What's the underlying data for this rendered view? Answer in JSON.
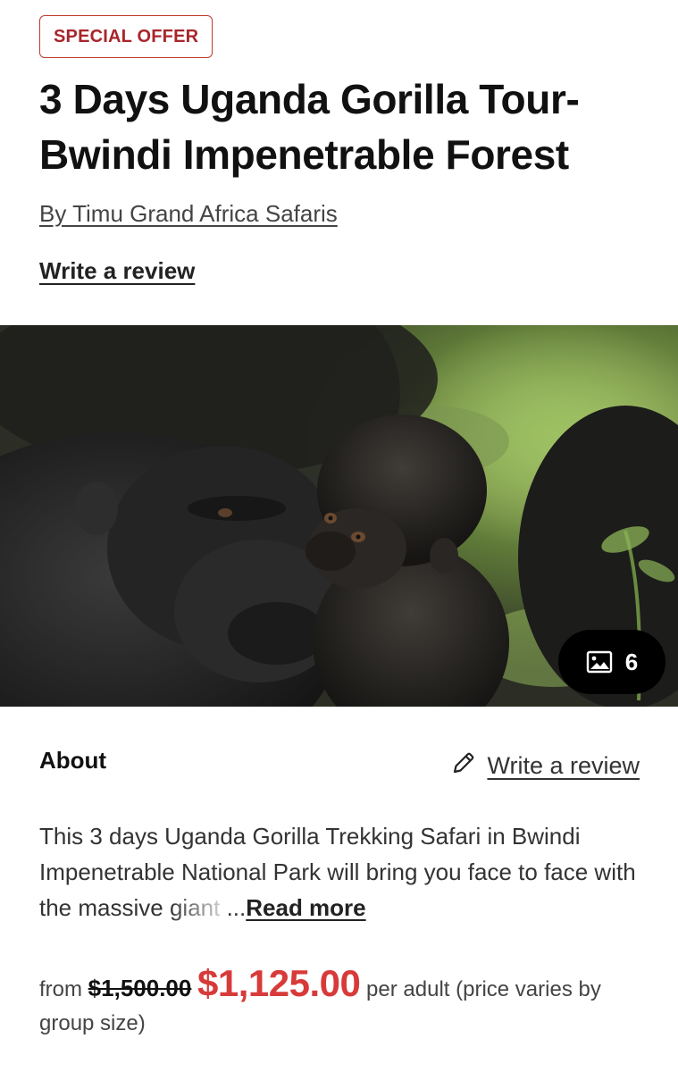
{
  "badge": "SPECIAL OFFER",
  "title": "3 Days Uganda Gorilla Tour- Bwindi Impenetrable Forest",
  "operator": "By Timu Grand Africa Safaris",
  "write_review_top": "Write a review",
  "gallery": {
    "photo_count": "6",
    "icon": "image-icon"
  },
  "about": {
    "label": "About",
    "write_review": "Write a review",
    "write_review_icon": "pencil-icon",
    "description_main": "This 3 days Uganda Gorilla Trekking Safari in Bwindi Impenetrable National Park will bring you face to face with the massive ",
    "description_faded": "giant",
    "ellipsis": "...",
    "read_more": "Read more"
  },
  "pricing": {
    "from": "from",
    "old_price": "$1,500.00",
    "new_price": "$1,125.00",
    "suffix": "per adult (price varies by group size)"
  },
  "colors": {
    "accent_red": "#d83a3a",
    "badge_red": "#a8262b"
  }
}
